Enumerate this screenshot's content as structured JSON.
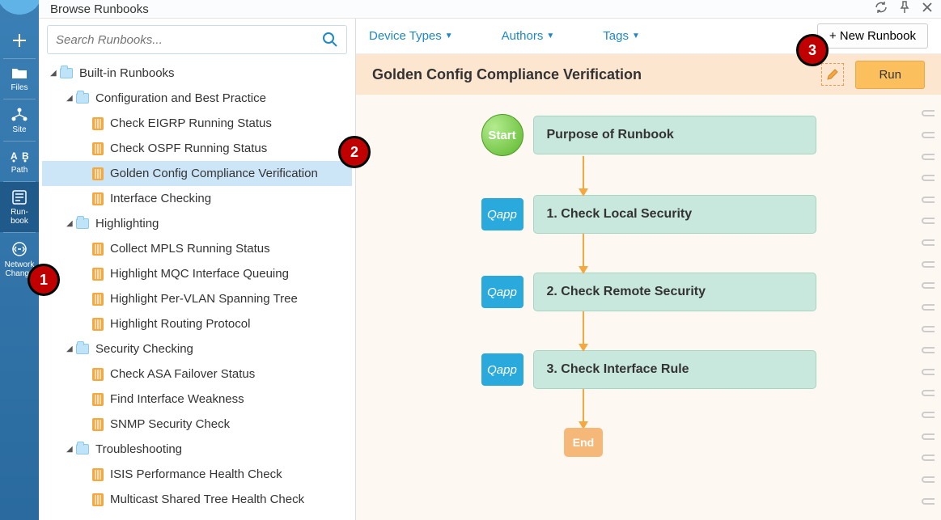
{
  "sidebar": {
    "items": [
      {
        "label": ""
      },
      {
        "label": "Files"
      },
      {
        "label": "Site"
      },
      {
        "label": "Path"
      },
      {
        "label": "Run-\nbook"
      },
      {
        "label": "Network\nChange"
      }
    ]
  },
  "titlebar": {
    "title": "Browse Runbooks"
  },
  "search": {
    "placeholder": "Search Runbooks..."
  },
  "tree": {
    "root": "Built-in Runbooks",
    "groups": [
      {
        "name": "Configuration and Best Practice",
        "items": [
          "Check EIGRP Running Status",
          "Check OSPF Running Status",
          "Golden Config Compliance Verification",
          "Interface Checking"
        ],
        "selected_index": 2
      },
      {
        "name": "Highlighting",
        "items": [
          "Collect MPLS Running Status",
          "Highlight MQC Interface Queuing",
          "Highlight Per-VLAN Spanning Tree",
          "Highlight Routing Protocol"
        ]
      },
      {
        "name": "Security Checking",
        "items": [
          "Check ASA Failover Status",
          "Find Interface Weakness",
          "SNMP Security Check"
        ]
      },
      {
        "name": "Troubleshooting",
        "items": [
          "ISIS Performance Health Check",
          "Multicast Shared Tree Health Check"
        ]
      }
    ]
  },
  "toolbar": {
    "filters": [
      "Device Types",
      "Authors",
      "Tags"
    ],
    "new_runbook": "+ New Runbook"
  },
  "detail": {
    "title": "Golden Config Compliance Verification",
    "run_label": "Run",
    "start_label": "Start",
    "qapp_label": "Qapp",
    "end_label": "End",
    "steps": [
      "Purpose of Runbook",
      "1. Check Local Security",
      "2. Check Remote Security",
      "3. Check Interface Rule"
    ]
  },
  "callouts": [
    "1",
    "2",
    "3"
  ]
}
